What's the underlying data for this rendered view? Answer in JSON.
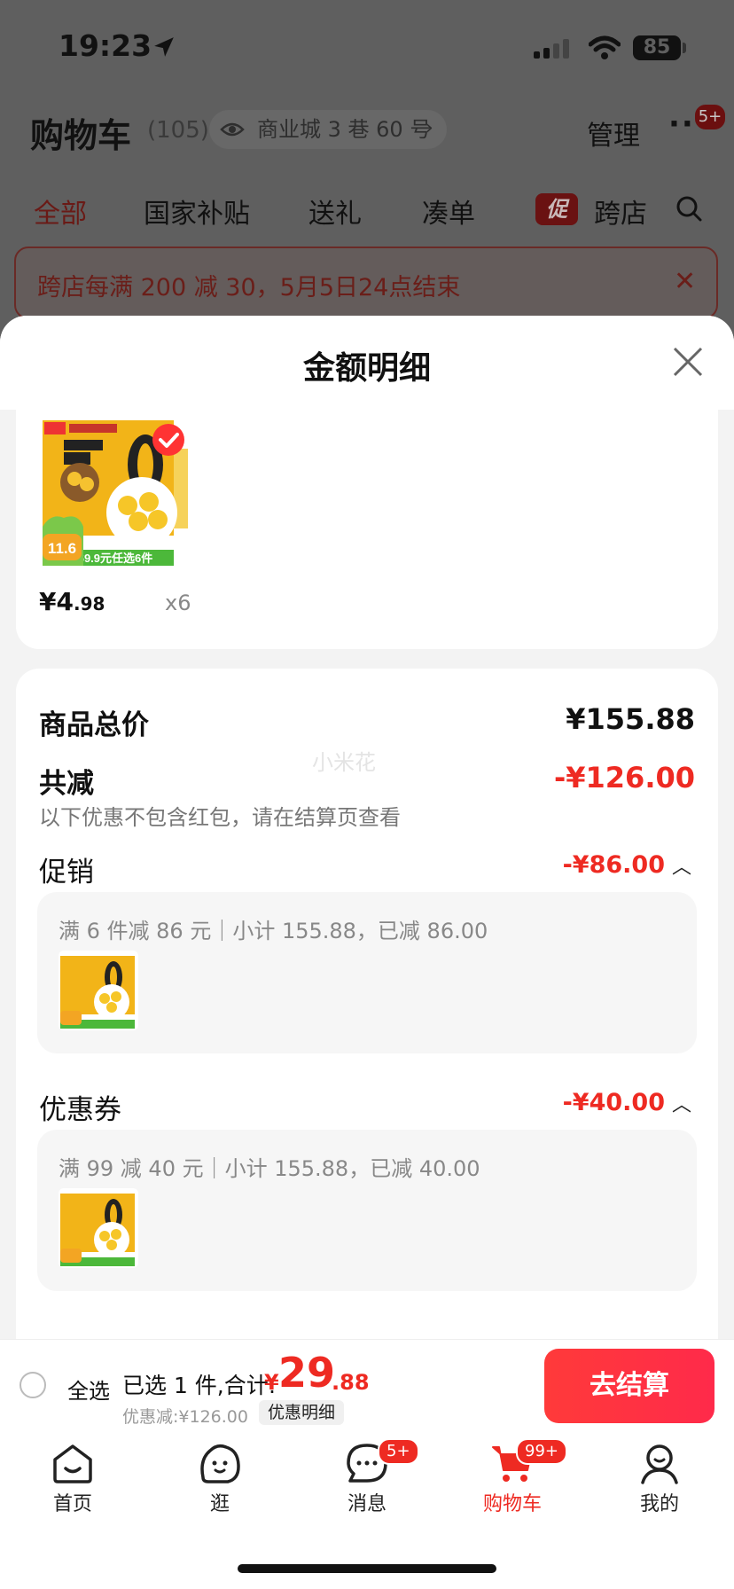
{
  "status_bar": {
    "time": "19:23",
    "battery": "85"
  },
  "cart_header": {
    "title": "购物车",
    "count": "(105)",
    "address": "商业城 3 巷 60 号",
    "manage": "管理",
    "more": "···",
    "more_badge": "5+"
  },
  "filter_tabs": {
    "all": "全部",
    "subsidy": "国家补贴",
    "gift": "送礼",
    "bundle": "凑单",
    "promo_tag": "促",
    "cross_store": "跨店"
  },
  "promo_banner": {
    "text": "跨店每满 200 减 30，5月5日24点结束"
  },
  "sheet": {
    "title": "金额明细",
    "product": {
      "price_int": "¥4",
      "price_dec": ".98",
      "qty": "x6",
      "img_badge": "11.6",
      "img_strip": "69.9元任选6件"
    },
    "summary": {
      "total_label": "商品总价",
      "total_value": "¥155.88",
      "watermark": "小米花",
      "reduce_label": "共减",
      "reduce_value": "-¥126.00",
      "reduce_note": "以下优惠不包含红包，请在结算页查看",
      "promo_label": "促销",
      "promo_value": "-¥86.00",
      "promo_detail": "满 6 件减 86 元｜小计 155.88，已减 86.00",
      "coupon_label": "优惠券",
      "coupon_value": "-¥40.00",
      "coupon_detail": "满 99 减 40 元｜小计 155.88，已减 40.00"
    }
  },
  "checkout_bar": {
    "select_all": "全选",
    "selected_info": "已选 1 件,合计:",
    "currency": "¥",
    "total_int": "29",
    "total_dec": ".88",
    "discount_info": "优惠减:¥126.00",
    "detail_button": "优惠明细",
    "checkout_button": "去结算"
  },
  "tab_bar": {
    "items": [
      {
        "label": "首页",
        "icon": "home-icon"
      },
      {
        "label": "逛",
        "icon": "browse-face-icon"
      },
      {
        "label": "消息",
        "icon": "message-icon",
        "badge": "5+"
      },
      {
        "label": "购物车",
        "icon": "cart-icon",
        "badge": "99+",
        "active": true
      },
      {
        "label": "我的",
        "icon": "profile-icon"
      }
    ]
  },
  "colors": {
    "accent": "#ee2a22",
    "overlay": "#5f5f5f",
    "sheet_bg": "#f3f3f3"
  }
}
